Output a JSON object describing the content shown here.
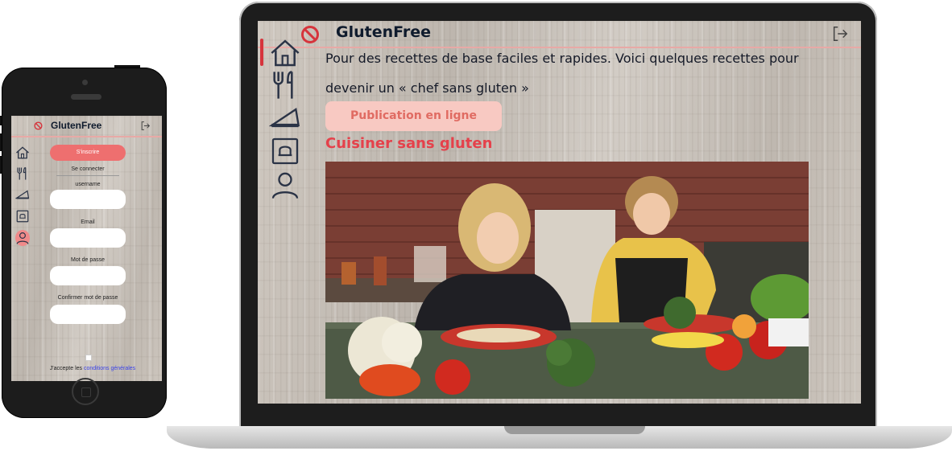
{
  "brand": {
    "name": "GlutenFree",
    "accent": "#e5414b",
    "dark": "#0f1b2d"
  },
  "phone": {
    "signup_label": "S'inscrire",
    "login_label": "Se connecter",
    "fields": [
      {
        "label": "username",
        "value": ""
      },
      {
        "label": "Email",
        "value": ""
      },
      {
        "label": "Mot de passe",
        "value": ""
      },
      {
        "label": "Confirmer mot de passe",
        "value": ""
      }
    ],
    "terms_prefix": "J'accepte les",
    "terms_link": "conditions générales",
    "nav_icons": [
      "home-icon",
      "cutlery-icon",
      "pie-icon",
      "recipe-book-icon",
      "user-icon"
    ],
    "active_nav": "user-icon"
  },
  "laptop": {
    "intro_text": "Pour des recettes de base faciles et rapides. Voici quelques recettes pour devenir un « chef sans gluten »",
    "publish_button": "Publication en ligne",
    "section_title": "Cuisiner sans gluten",
    "nav_icons": [
      "home-icon",
      "cutlery-icon",
      "pie-icon",
      "recipe-book-icon",
      "user-icon"
    ],
    "active_nav": "home-icon"
  }
}
